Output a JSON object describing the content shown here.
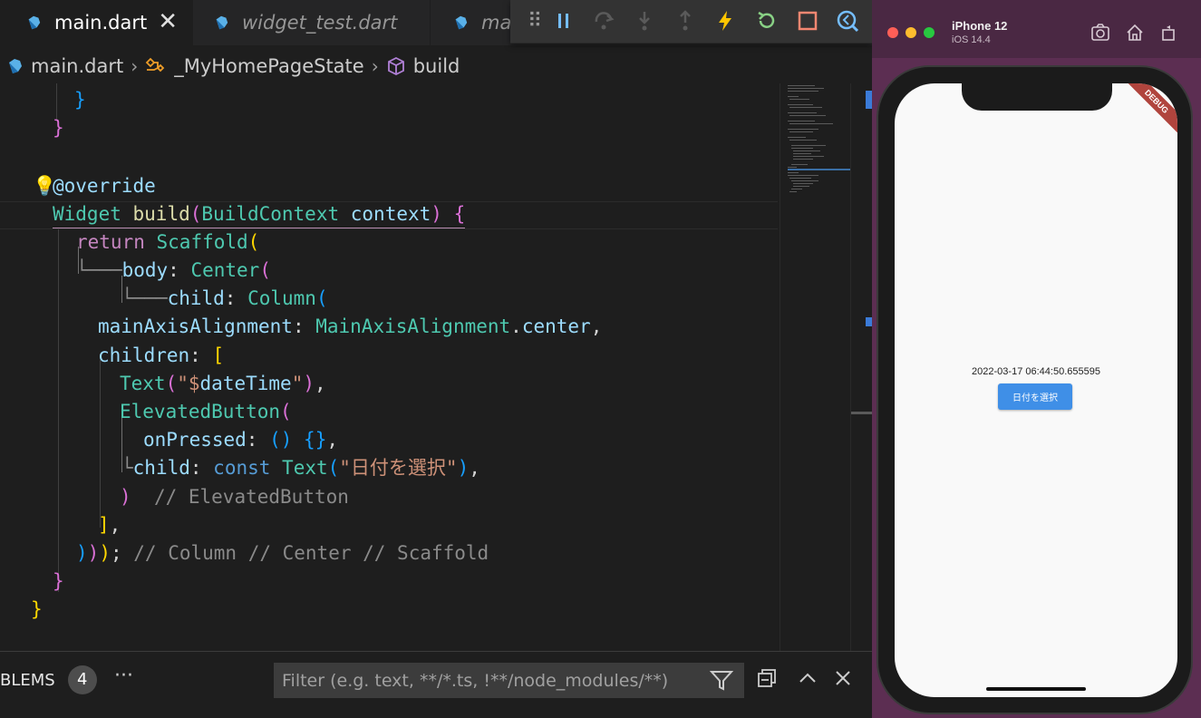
{
  "tabs": [
    {
      "label": "main.dart",
      "active": true
    },
    {
      "label": "widget_test.dart",
      "active": false
    },
    {
      "label": "mai",
      "active": false
    }
  ],
  "breadcrumb": {
    "file": "main.dart",
    "class": "_MyHomePageState",
    "method": "build"
  },
  "debug_toolbar": [
    "drag-handle",
    "pause",
    "step-over",
    "step-into",
    "step-out",
    "hot-reload",
    "hot-restart",
    "stop",
    "devtools"
  ],
  "code": {
    "l0": "}",
    "l1": "}",
    "l3_ann": "@override",
    "l4_type": "Widget",
    "l4_fn": "build",
    "l4_param_type": "BuildContext",
    "l4_param": "context",
    "l5_kw": "return",
    "l5_cls": "Scaffold",
    "l6_prop": "body",
    "l6_cls": "Center",
    "l7_prop": "child",
    "l7_cls": "Column",
    "l8_prop": "mainAxisAlignment",
    "l8_cls": "MainAxisAlignment",
    "l8_val": "center",
    "l9_prop": "children",
    "l10_cls": "Text",
    "l10_str_a": "\"$",
    "l10_var": "dateTime",
    "l10_str_b": "\"",
    "l11_cls": "ElevatedButton",
    "l12_prop": "onPressed",
    "l13_prop": "child",
    "l13_kw": "const",
    "l13_cls": "Text",
    "l13_str": "\"日付を選択\"",
    "l14_cm": "// ElevatedButton",
    "l16_cm": "// Column // Center // Scaffold"
  },
  "panel": {
    "problems_label": "BLEMS",
    "problems_count": "4",
    "more": "···",
    "filter_placeholder": "Filter (e.g. text, **/*.ts, !**/node_modules/**)"
  },
  "simulator": {
    "device": "iPhone 12",
    "os": "iOS 14.4",
    "debug_banner": "DEBUG",
    "app_date_text": "2022-03-17 06:44:50.655595",
    "app_button_label": "日付を選択"
  },
  "colors": {
    "accent": "#007acc",
    "app_button": "#3f8fe7",
    "sim_bg": "#5c2e52"
  }
}
